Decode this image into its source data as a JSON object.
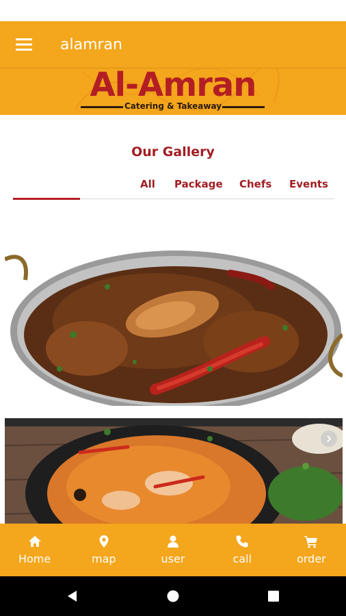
{
  "app_bar": {
    "title": "alamran",
    "menu_icon": "hamburger-icon"
  },
  "logo": {
    "name": "Al-Amran",
    "tagline": "Catering & Takeaway"
  },
  "gallery": {
    "title": "Our Gallery",
    "tabs": [
      {
        "label": "All",
        "selected": true
      },
      {
        "label": "Package",
        "selected": false
      },
      {
        "label": "Chefs",
        "selected": false
      },
      {
        "label": "Events",
        "selected": false
      }
    ]
  },
  "bottom_nav": [
    {
      "label": "Home",
      "icon": "home-icon"
    },
    {
      "label": "map",
      "icon": "map-pin-icon"
    },
    {
      "label": "user",
      "icon": "user-icon"
    },
    {
      "label": "call",
      "icon": "phone-icon"
    },
    {
      "label": "order",
      "icon": "cart-icon"
    }
  ],
  "colors": {
    "accent": "#f4a61c",
    "brand_red": "#a11d22",
    "tab_indicator": "#b51e24"
  }
}
